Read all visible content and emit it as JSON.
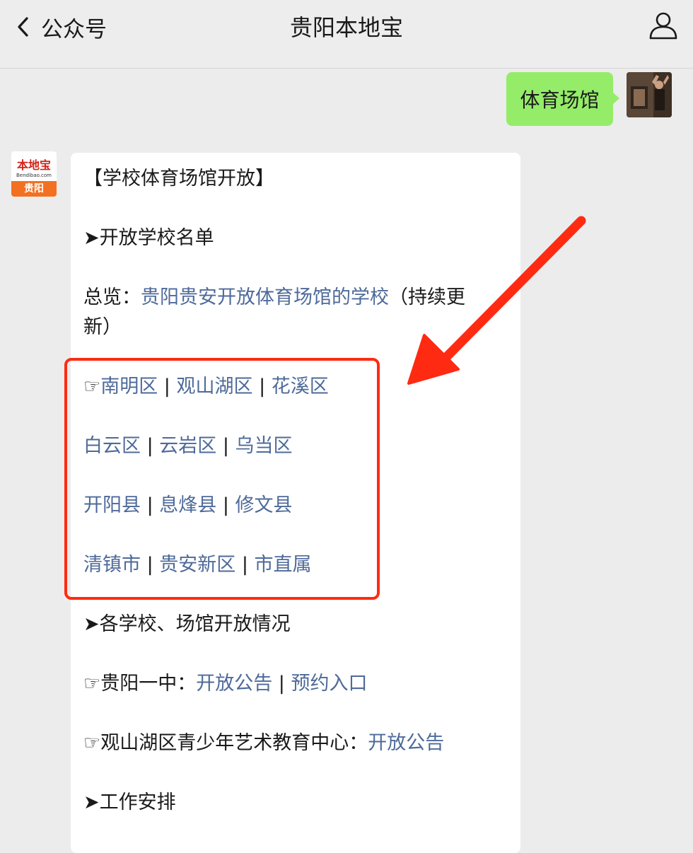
{
  "header": {
    "back_label": "公众号",
    "title": "贵阳本地宝"
  },
  "sent_message": {
    "text": "体育场馆"
  },
  "bot_avatar": {
    "logo_text": "本地宝",
    "url": "Bendibao.com",
    "city": "贵阳"
  },
  "reply": {
    "heading": "【学校体育场馆开放】",
    "section1": "➤开放学校名单",
    "overview_prefix": "总览：",
    "overview_link": "贵阳贵安开放体育场馆的学校",
    "overview_suffix1": "（持续更",
    "overview_suffix2": "新）",
    "hand": "☞",
    "sep": " | ",
    "districts_row1": [
      "南明区",
      "观山湖区",
      "花溪区"
    ],
    "districts_row2": [
      "白云区",
      "云岩区",
      "乌当区"
    ],
    "districts_row3": [
      "开阳县",
      "息烽县",
      "修文县"
    ],
    "districts_row4": [
      "清镇市",
      "贵安新区",
      "市直属"
    ],
    "section2": "➤各学校、场馆开放情况",
    "school1_name": "贵阳一中：",
    "school1_link1": "开放公告",
    "school1_link2": "预约入口",
    "school2_name": "观山湖区青少年艺术教育中心：",
    "school2_link1": "开放公告",
    "section3": "➤工作安排"
  },
  "colors": {
    "sent_bubble": "#95ec69",
    "link": "#4e6a9a",
    "highlight": "#ff2a12",
    "background": "#ececec"
  },
  "icons": {
    "back": "chevron-left-icon",
    "user": "user-icon",
    "annotation": "red-arrow"
  }
}
